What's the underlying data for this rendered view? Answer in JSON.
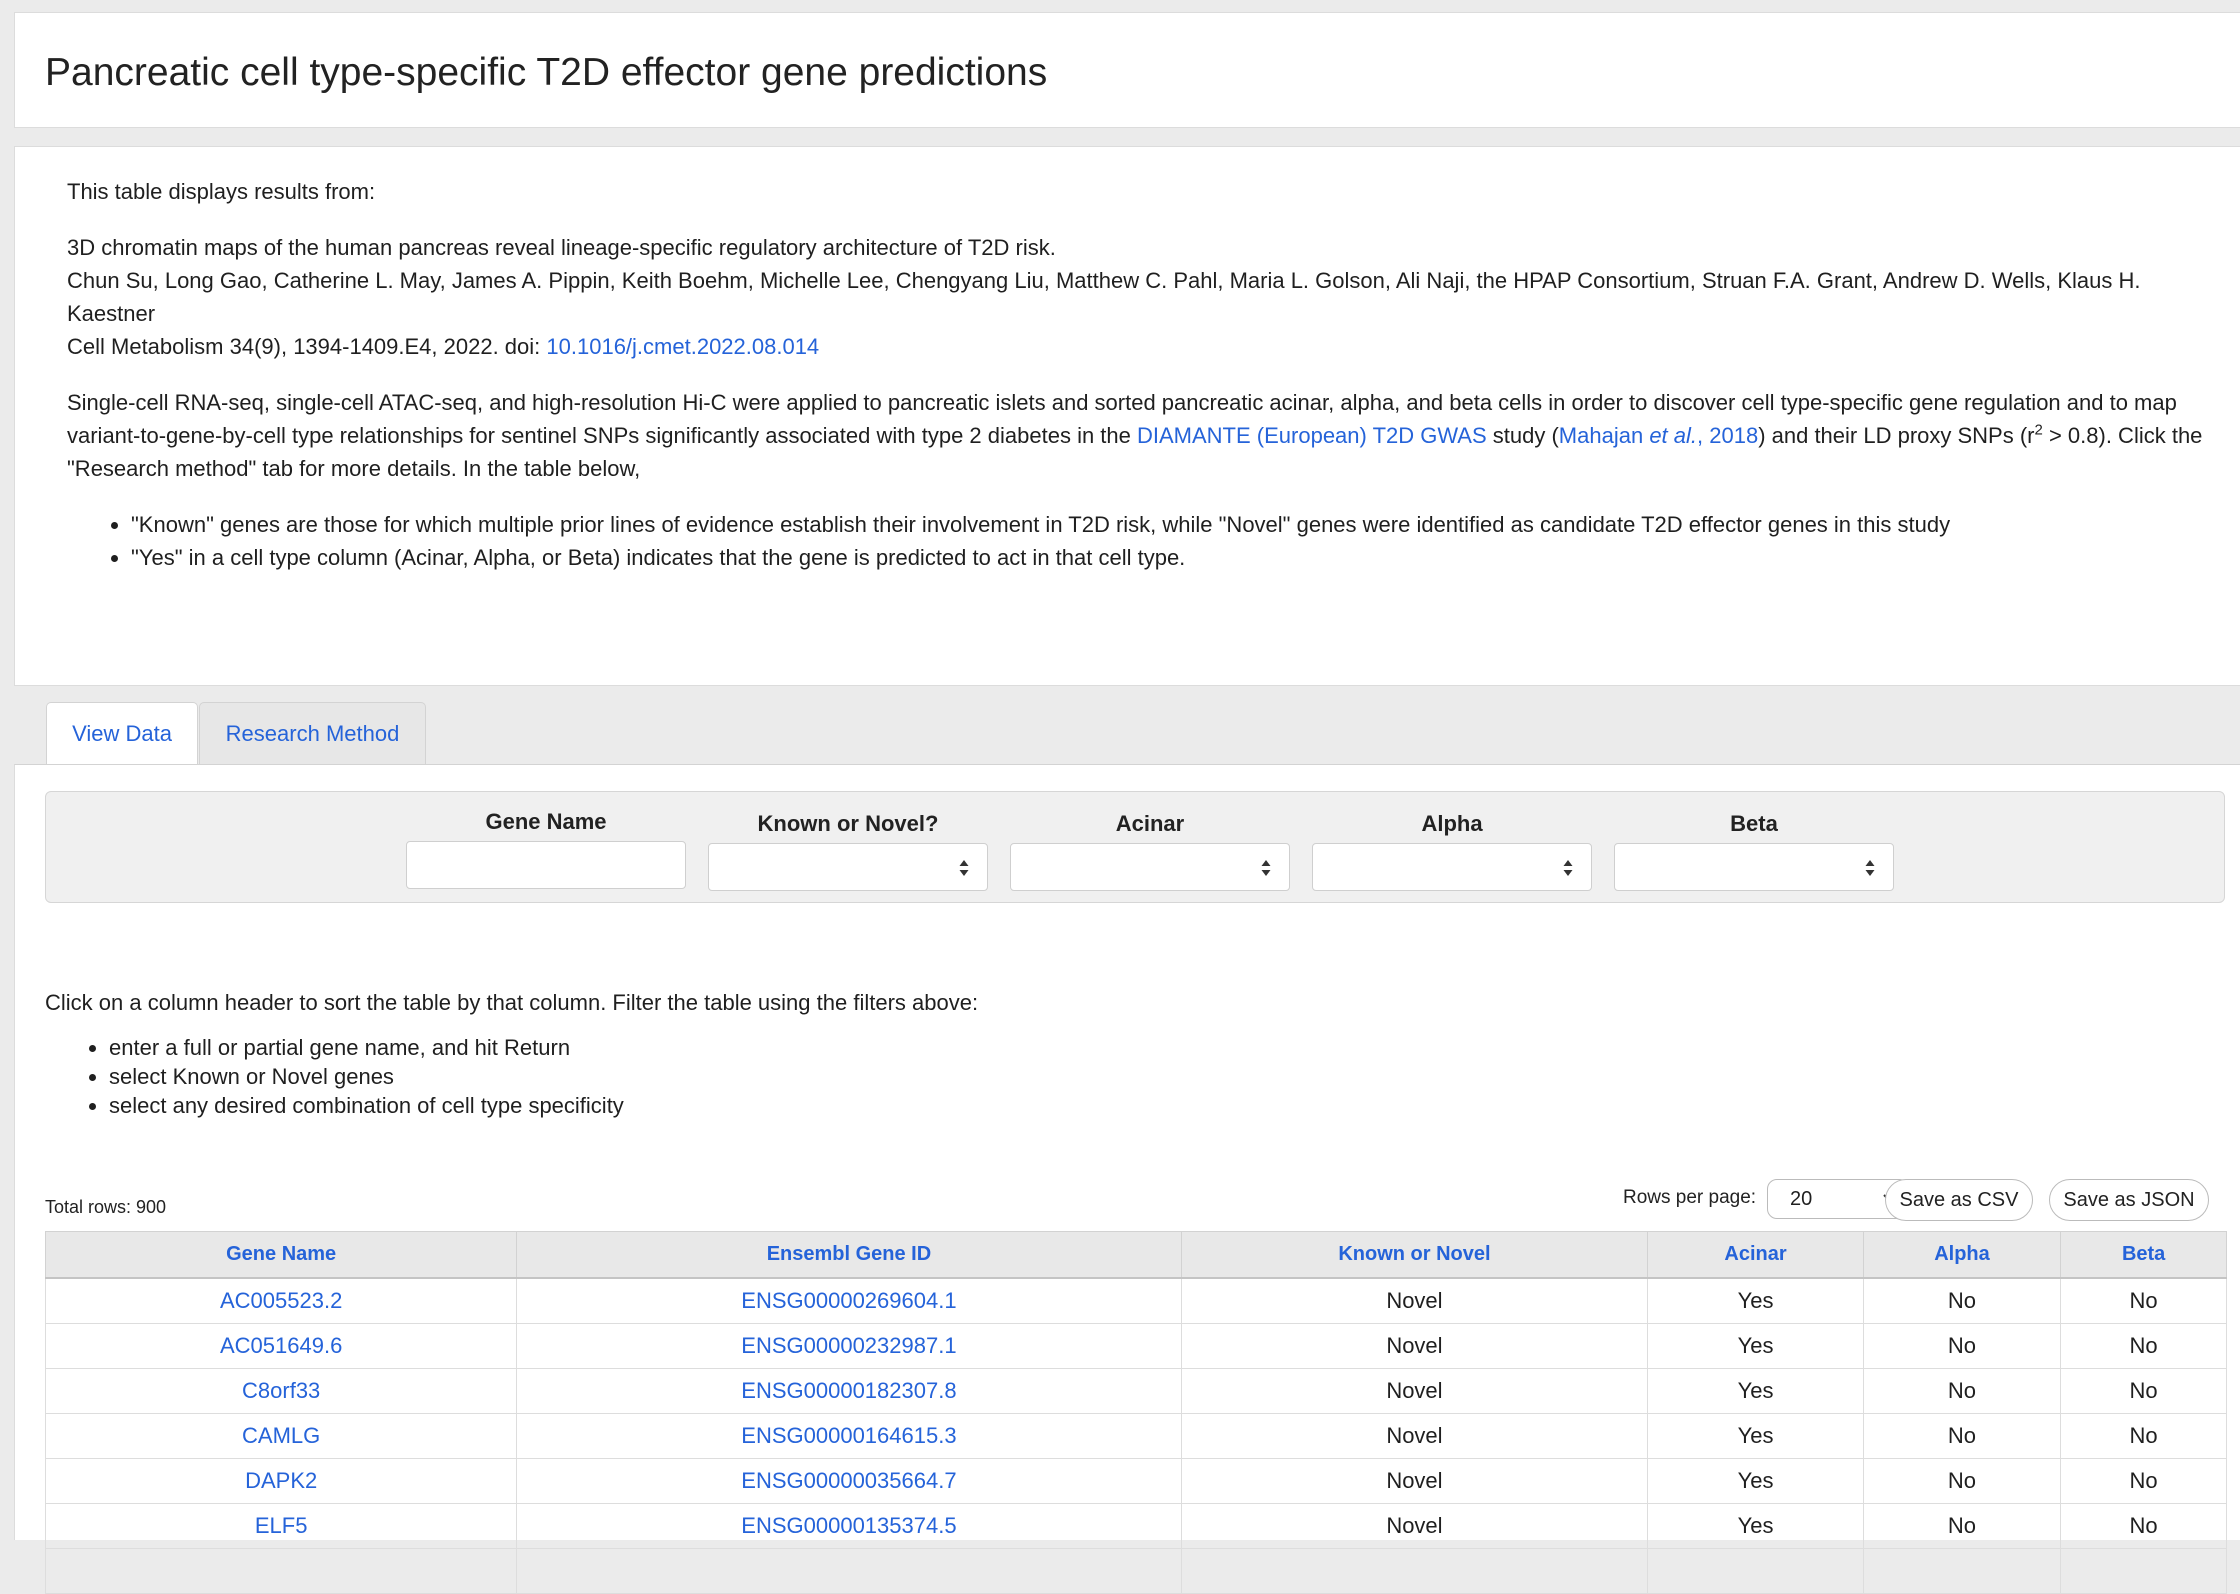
{
  "page": {
    "title": "Pancreatic cell type-specific T2D effector gene predictions"
  },
  "intro": {
    "lead": "This table displays results from:",
    "citation": {
      "paper_title": "3D chromatin maps of the human pancreas reveal lineage-specific regulatory architecture of T2D risk.",
      "authors": "Chun Su, Long Gao, Catherine L. May, James A. Pippin, Keith Boehm, Michelle Lee, Chengyang Liu, Matthew C. Pahl, Maria L. Golson, Ali Naji, the HPAP Consortium, Struan F.A. Grant, Andrew D. Wells, Klaus H. Kaestner",
      "journal": "Cell Metabolism 34(9), 1394-1409.E4, 2022. doi: ",
      "doi_link": "10.1016/j.cmet.2022.08.014"
    },
    "description": {
      "part1": "Single-cell RNA-seq, single-cell ATAC-seq, and high-resolution Hi-C were applied to pancreatic islets and sorted pancreatic acinar, alpha, and beta cells in order to discover cell type-specific gene regulation and to map variant-to-gene-by-cell type relationships for sentinel SNPs significantly associated with type 2 diabetes in the ",
      "gwas_link": "DIAMANTE (European) T2D GWAS",
      "part2": " study (",
      "ref_link_name": "Mahajan ",
      "ref_link_etal": "et al.",
      "ref_link_year": ", 2018",
      "part3": ") and their LD proxy SNPs (r",
      "superscript": "2",
      "part4": " > 0.8). Click the \"Research method\" tab for more details. In the table below,"
    },
    "bullets": [
      "\"Known\" genes are those for which multiple prior lines of evidence establish their involvement in T2D risk, while \"Novel\" genes were identified as candidate T2D effector genes in this study",
      "\"Yes\" in a cell type column (Acinar, Alpha, or Beta) indicates that the gene is predicted to act in that cell type."
    ]
  },
  "tabs": [
    {
      "label": "View Data",
      "active": true
    },
    {
      "label": "Research Method",
      "active": false
    }
  ],
  "filters": {
    "gene_name": {
      "label": "Gene Name",
      "value": ""
    },
    "known_novel": {
      "label": "Known or Novel?",
      "value": ""
    },
    "acinar": {
      "label": "Acinar",
      "value": ""
    },
    "alpha": {
      "label": "Alpha",
      "value": ""
    },
    "beta": {
      "label": "Beta",
      "value": ""
    }
  },
  "instructions": {
    "lead": "Click on a column header to sort the table by that column. Filter the table using the filters above:",
    "items": [
      "enter a full or partial gene name, and hit Return",
      "select Known or Novel genes",
      "select any desired combination of cell type specificity"
    ]
  },
  "table_controls": {
    "total_rows": "Total rows: 900",
    "rows_per_page_label": "Rows per page:",
    "rows_per_page_value": "20",
    "save_csv": "Save as CSV",
    "save_json": "Save as JSON"
  },
  "table": {
    "columns": [
      "Gene Name",
      "Ensembl Gene ID",
      "Known or Novel",
      "Acinar",
      "Alpha",
      "Beta"
    ],
    "rows": [
      [
        "AC005523.2",
        "ENSG00000269604.1",
        "Novel",
        "Yes",
        "No",
        "No"
      ],
      [
        "AC051649.6",
        "ENSG00000232987.1",
        "Novel",
        "Yes",
        "No",
        "No"
      ],
      [
        "C8orf33",
        "ENSG00000182307.8",
        "Novel",
        "Yes",
        "No",
        "No"
      ],
      [
        "CAMLG",
        "ENSG00000164615.3",
        "Novel",
        "Yes",
        "No",
        "No"
      ],
      [
        "DAPK2",
        "ENSG00000035664.7",
        "Novel",
        "Yes",
        "No",
        "No"
      ],
      [
        "ELF5",
        "ENSG00000135374.5",
        "Novel",
        "Yes",
        "No",
        "No"
      ],
      [
        "",
        "",
        "",
        "",
        "",
        ""
      ]
    ]
  }
}
